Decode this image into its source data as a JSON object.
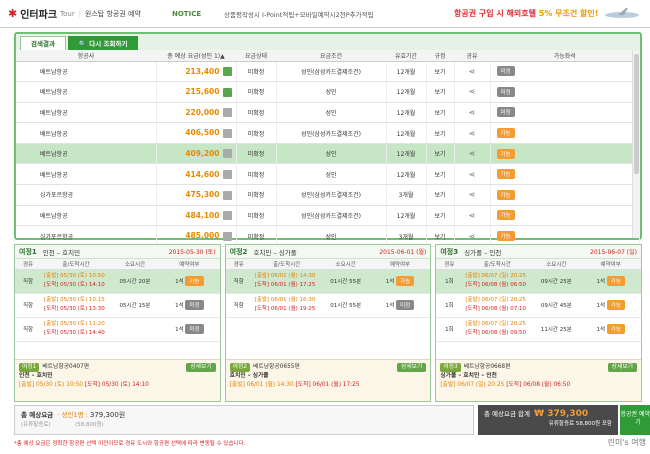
{
  "header": {
    "brand": "인터파크",
    "tour": "Tour",
    "divider": "|",
    "subtitle": "원스탑 항공권 예약",
    "notice_label": "NOTICE",
    "notice_text": "상품평작성시 I-Point적립+모바일예약시2천P추가적립",
    "ad_text": "항공권 구입 시 해외호텔",
    "ad_pct": "5% 무조건 할인!"
  },
  "tabs": [
    {
      "label": "검색결과"
    },
    {
      "label": "다시 조회하기"
    }
  ],
  "grid": {
    "headers": [
      "항공사",
      "총 예상 요금(성인 1)▲",
      "요금상태",
      "요금조건",
      "유효기간",
      "규정",
      "공유",
      "가능좌석"
    ],
    "rows": [
      {
        "airline": "베트남항공",
        "price": "213,400",
        "status": "미확정",
        "cond": "성인(삼성카드결제조건)",
        "valid": "12개월",
        "rule": "보기",
        "btn": "미정"
      },
      {
        "airline": "베트남항공",
        "price": "215,600",
        "status": "미확정",
        "cond": "성인",
        "valid": "12개월",
        "rule": "보기",
        "btn": "미정"
      },
      {
        "airline": "베트남항공",
        "price": "220,000",
        "status": "미확정",
        "cond": "성인",
        "valid": "12개월",
        "rule": "보기",
        "btn": "미정"
      },
      {
        "airline": "베트남항공",
        "price": "406,500",
        "status": "미확정",
        "cond": "성인(삼성카드결제조건)",
        "valid": "12개월",
        "rule": "보기",
        "btn": "가능"
      },
      {
        "airline": "베트남항공",
        "price": "409,200",
        "status": "미확정",
        "cond": "성인",
        "valid": "12개월",
        "rule": "보기",
        "btn": "가능"
      },
      {
        "airline": "베트남항공",
        "price": "414,600",
        "status": "미확정",
        "cond": "성인",
        "valid": "12개월",
        "rule": "보기",
        "btn": "가능"
      },
      {
        "airline": "싱가포르항공",
        "price": "475,300",
        "status": "미확정",
        "cond": "성인(삼성카드결제조건)",
        "valid": "3개월",
        "rule": "보기",
        "btn": "가능"
      },
      {
        "airline": "베트남항공",
        "price": "484,100",
        "status": "미확정",
        "cond": "성인(삼성카드결제조건)",
        "valid": "12개월",
        "rule": "보기",
        "btn": "가능"
      },
      {
        "airline": "싱가포르항공",
        "price": "485,000",
        "status": "미확정",
        "cond": "성인",
        "valid": "3개월",
        "rule": "보기",
        "btn": "가능"
      }
    ]
  },
  "panels": [
    {
      "title": "여정1",
      "route": "인천 – 호치민",
      "date": "2015-05-30 (토)",
      "headers": [
        "경유",
        "출/도착시간",
        "소요시간",
        "예약여부"
      ],
      "rows": [
        {
          "stop": "직항",
          "dep": "[출발] 05/30 (토) 10:50",
          "arr": "[도착] 05/30 (토) 14:10",
          "dur": "05시간 20분",
          "seat": "1석",
          "btn": "가능"
        },
        {
          "stop": "직항",
          "dep": "[출발] 05/30 (토) 10:15",
          "arr": "[도착] 05/30 (토) 13:30",
          "dur": "05시간 15분",
          "seat": "1석",
          "btn": "미정"
        },
        {
          "stop": "직항",
          "dep": "[출발] 05/30 (토) 11:20",
          "arr": "[도착] 05/30 (토) 14:40",
          "dur": "",
          "seat": "1석",
          "btn": "미정"
        }
      ],
      "sum": {
        "badge": "여정1",
        "flight": "베트남항공0407편",
        "route": "인천 – 호치민",
        "dep": "[출발] 05/30 (토) 10:50",
        "arr": "[도착] 05/30 (토) 14:10",
        "sel": "상세보기"
      }
    },
    {
      "title": "여정2",
      "route": "호치민 – 싱가폴",
      "date": "2015-06-01 (월)",
      "headers": [
        "경유",
        "출/도착시간",
        "소요시간",
        "예약여부"
      ],
      "rows": [
        {
          "stop": "직항",
          "dep": "[출발] 06/01 (월) 14:30",
          "arr": "[도착] 06/01 (월) 17:25",
          "dur": "01시간 55분",
          "seat": "1석",
          "btn": "가능"
        },
        {
          "stop": "직항",
          "dep": "[출발] 06/01 (월) 16:30",
          "arr": "[도착] 06/01 (월) 19:25",
          "dur": "01시간 55분",
          "seat": "1석",
          "btn": "미정"
        }
      ],
      "sum": {
        "badge": "여정2",
        "flight": "베트남항공0655편",
        "route": "호치민 – 싱가폴",
        "dep": "[출발] 06/01 (월) 14:30",
        "arr": "[도착] 06/01 (월) 17:25",
        "sel": "상세보기"
      }
    },
    {
      "title": "여정3",
      "route": "싱가폴 – 인천",
      "date": "2015-06-07 (일)",
      "headers": [
        "경유",
        "출/도착시간",
        "소요시간",
        "예약여부"
      ],
      "rows": [
        {
          "stop": "1회",
          "dep": "[출발] 06/07 (일) 20:25",
          "arr": "[도착] 06/08 (월) 06:50",
          "dur": "09시간 25분",
          "seat": "1석",
          "btn": "가능"
        },
        {
          "stop": "1회",
          "dep": "[출발] 06/07 (일) 20:25",
          "arr": "[도착] 06/08 (월) 07:10",
          "dur": "09시간 45분",
          "seat": "1석",
          "btn": "가능"
        },
        {
          "stop": "1회",
          "dep": "[출발] 06/07 (일) 20:25",
          "arr": "[도착] 06/08 (월) 09:50",
          "dur": "11시간 25분",
          "seat": "1석",
          "btn": "가능"
        }
      ],
      "sum": {
        "badge": "여정3",
        "flight": "베트남항공0668편",
        "route": "싱가폴 – 호치민 – 인천",
        "dep": "[출발] 06/07 (일) 20:25",
        "arr": "[도착] 06/08 (월) 06:50",
        "sel": "상세보기"
      }
    }
  ],
  "total": {
    "label": "총 예상요금",
    "sub_label": "(유류할증료)",
    "adult": "· 성인1명 :",
    "amount": "379,300원",
    "fuel": "(58,800원)",
    "right_label": "총 예상요금 합계",
    "right_amount": "₩ 379,300",
    "right_note": "유류할증료 58,800원 포함",
    "pay_btn": "항공권 예약하기",
    "warning": "*총 예상 요금은 정확한 항공편 선택 이전이므로 경유 도시와 항공편 선택에 따라 변동될 수 있습니다."
  },
  "watermark": "린미's 여행"
}
